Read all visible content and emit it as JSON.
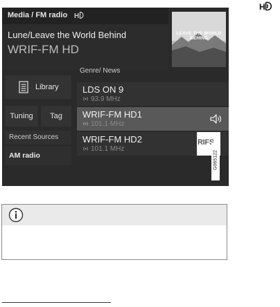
{
  "header_icon": "hd-radio-icon",
  "radio": {
    "breadcrumb": "Media / FM radio",
    "breadcrumb_icon": "hd-radio-icon",
    "now_playing": {
      "song": "Lune/Leave the World Behind",
      "station": "WRIF-FM HD",
      "album_art_text": "LEAVE THE WORLD BEHIND"
    },
    "buttons": {
      "library": "Library",
      "tuning": "Tuning",
      "tag": "Tag"
    },
    "recent": {
      "header": "Recent Sources",
      "items": [
        "AM radio"
      ]
    },
    "list": {
      "header": "Genre/ News",
      "rows": [
        {
          "name": "LDS ON 9",
          "freq": "93.9  MHz"
        },
        {
          "name": "WRIF-FM HD1",
          "freq": "101.1  MHz"
        },
        {
          "name": "WRIF-FM HD2",
          "freq": "101.1  MHz"
        }
      ],
      "selected_index": 1,
      "logo_text": "RIFS"
    },
    "image_code": "G065122"
  },
  "info_box": {
    "icon": "info-icon"
  },
  "colors": {
    "screen_bg": "#2a2a2a",
    "selected_row": "#595959",
    "info_header": "#eaeaea"
  }
}
